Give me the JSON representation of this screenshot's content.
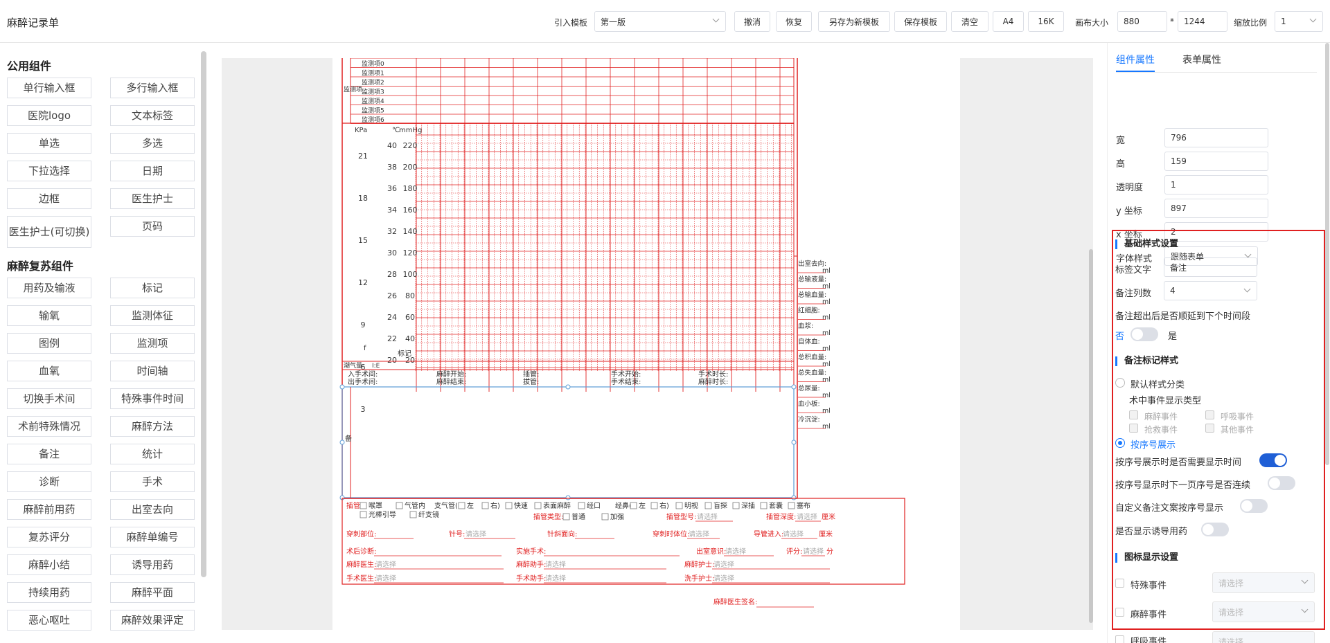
{
  "app": {
    "title": "麻醉记录单"
  },
  "toolbar": {
    "template_label": "引入模板",
    "template_value": "第一版",
    "buttons": {
      "undo": "撤消",
      "redo": "恢复",
      "save_new": "另存为新模板",
      "save": "保存模板",
      "clear": "清空",
      "a4": "A4",
      "16k": "16K"
    },
    "canvas_size_label": "画布大小",
    "width": "880",
    "times": "*",
    "height": "1244",
    "zoom_label": "缩放比例",
    "zoom": "1"
  },
  "sidebar": {
    "group1_title": "公用组件",
    "group1": [
      "单行输入框",
      "多行输入框",
      "医院logo",
      "文本标签",
      "单选",
      "多选",
      "下拉选择",
      "日期",
      "边框",
      "医生护士",
      "医生护士(可切换)",
      "页码"
    ],
    "group2_title": "麻醉复苏组件",
    "group2": [
      "用药及输液",
      "标记",
      "输氧",
      "监测体征",
      "图例",
      "监测项",
      "血氧",
      "时间轴",
      "切换手术间",
      "特殊事件时间",
      "术前特殊情况",
      "麻醉方法",
      "备注",
      "统计",
      "诊断",
      "手术",
      "麻醉前用药",
      "出室去向",
      "复苏评分",
      "麻醉单编号",
      "麻醉小结",
      "诱导用药",
      "持续用药",
      "麻醉平面",
      "恶心呕吐",
      "麻醉效果评定"
    ]
  },
  "doc": {
    "monitor_section": "监测项",
    "monitor_items": [
      "监测项0",
      "监测项1",
      "监测项2",
      "监测项3",
      "监测项4",
      "监测项5",
      "监测项6"
    ],
    "axis_heads": [
      "KPa",
      "℃",
      "mmHg"
    ],
    "kpa": [
      "21",
      "18",
      "15",
      "12",
      "9",
      "6",
      "3"
    ],
    "celsius": [
      "40",
      "38",
      "36",
      "34",
      "32",
      "30",
      "28",
      "26",
      "24",
      "22",
      "20"
    ],
    "mmhg": [
      "220",
      "200",
      "180",
      "160",
      "140",
      "120",
      "100",
      "80",
      "60",
      "40",
      "20"
    ],
    "f_mark": "f",
    "tidal": "潮气量",
    "ie": "I:E",
    "mark": "标记",
    "times_row1": [
      "入手术间:",
      "麻醉开始:",
      "插管:",
      "手术开始:",
      "手术时长:"
    ],
    "times_row2": [
      "出手术间:",
      "麻醉结束:",
      "拔管:",
      "手术结束:",
      "麻醉时长:"
    ],
    "notes_label": "备注",
    "right_col": [
      "出室去向:",
      "总输液量:",
      "总输血量:",
      "红细胞:",
      "血浆:",
      "自体血:",
      "总积血量:",
      "总失血量:",
      "总尿量:",
      "血小板:",
      "冷沉淀:"
    ],
    "unit_ml": "ml",
    "intub_label": "插管:",
    "intub_opts": [
      "喉罩",
      "气管内",
      "支气管(",
      "左",
      "右)",
      "快速",
      "表面麻醉",
      "经口",
      "经鼻(",
      "左",
      "右)",
      "明视",
      "盲探",
      "深插",
      "套囊",
      "塞布"
    ],
    "intub_opts2": [
      "光棒引导",
      "纤支镜"
    ],
    "tube_type": "插管类型:",
    "tube_type_opts": [
      "普通",
      "加强"
    ],
    "tube_model": "插管型号:",
    "depth": "插管深度:",
    "unit_cm": "厘米",
    "placeholder": "请选择",
    "punct_site": "穿刺部位:",
    "needle": "针号:",
    "needle_dir": "针斜面向:",
    "punct_pos": "穿刺时体位:",
    "catheter": "导管进入:",
    "post_diag": "术后诊断:",
    "surgery": "实施手术:",
    "consciousness": "出室意识:",
    "score": "评分:",
    "score_unit": "分",
    "anes_doc": "麻醉医生:",
    "anes_assist": "麻醉助手:",
    "anes_nurse": "麻醉护士:",
    "surg_doc": "手术医生:",
    "surg_assist": "手术助手:",
    "scrub_nurse": "洗手护士:",
    "signature": "麻醉医生签名:"
  },
  "right_panel": {
    "tabs": [
      "组件属性",
      "表单属性"
    ],
    "props": [
      {
        "label": "宽",
        "value": "796"
      },
      {
        "label": "高",
        "value": "159"
      },
      {
        "label": "透明度",
        "value": "1"
      },
      {
        "label": "y 坐标",
        "value": "897"
      },
      {
        "label": "x 坐标",
        "value": "2"
      }
    ],
    "font_label": "字体样式",
    "font_value": "跟随表单",
    "basic_title": "基础样式设置",
    "tag_label": "标签文字",
    "tag_value": "备注",
    "cols_label": "备注列数",
    "cols_value": "4",
    "overflow_label": "备注超出后是否顺延到下个时间段",
    "no": "否",
    "yes": "是",
    "mark_title": "备注标记样式",
    "default_style": "默认样式分类",
    "event_type": "术中事件显示类型",
    "events": [
      "麻醉事件",
      "呼吸事件",
      "抢救事件",
      "其他事件"
    ],
    "by_number": "按序号展示",
    "show_time": "按序号展示时是否需要显示时间",
    "continuous": "按序号显示时下一页序号是否连续",
    "custom": "自定义备注文案按序号显示",
    "show_induce": "是否显示诱导用药",
    "icon_title": "图标显示设置",
    "icon_rows": [
      "特殊事件",
      "麻醉事件",
      "呼吸事件"
    ]
  },
  "colors": {
    "accent": "#1677ff",
    "doc_red": "#e02020",
    "toggle_on": "#1f5fd6"
  }
}
